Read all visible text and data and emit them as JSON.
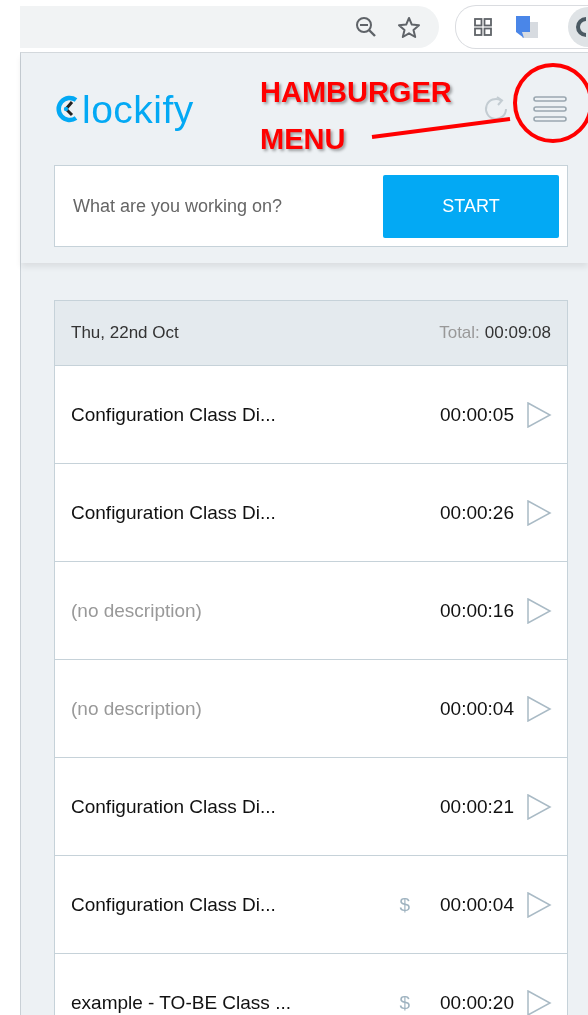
{
  "annotation": {
    "lines": [
      "HAMBURGER",
      "MENU"
    ]
  },
  "header": {
    "logo_text": "lockify"
  },
  "timer": {
    "placeholder": "What are you working on?",
    "start_button": "START"
  },
  "day": {
    "date": "Thu, 22nd Oct",
    "total_label": "Total:",
    "total": "00:09:08"
  },
  "entries": [
    {
      "description": "Configuration Class Di...",
      "missing_description": false,
      "billable": false,
      "duration": "00:00:05"
    },
    {
      "description": "Configuration Class Di...",
      "missing_description": false,
      "billable": false,
      "duration": "00:00:26"
    },
    {
      "description": "(no description)",
      "missing_description": true,
      "billable": false,
      "duration": "00:00:16"
    },
    {
      "description": "(no description)",
      "missing_description": true,
      "billable": false,
      "duration": "00:00:04"
    },
    {
      "description": "Configuration Class Di...",
      "missing_description": false,
      "billable": false,
      "duration": "00:00:21"
    },
    {
      "description": "Configuration Class Di...",
      "missing_description": false,
      "billable": true,
      "duration": "00:00:04"
    },
    {
      "description": "example - TO-BE Class ...",
      "missing_description": false,
      "billable": true,
      "duration": "00:00:20"
    }
  ],
  "billable_sign": "$"
}
